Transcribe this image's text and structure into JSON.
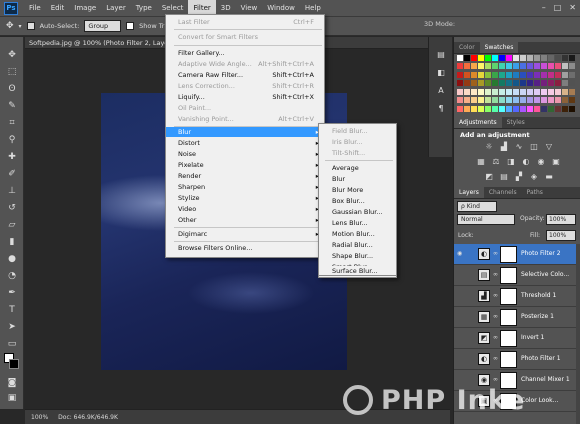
{
  "app": {
    "logo": "Ps",
    "window_controls": [
      "–",
      "□",
      "✕"
    ]
  },
  "menubar": {
    "items": [
      "File",
      "Edit",
      "Image",
      "Layer",
      "Type",
      "Select",
      "Filter",
      "3D",
      "View",
      "Window",
      "Help"
    ],
    "active": "Filter"
  },
  "options": {
    "auto_select_label": "Auto-Select:",
    "auto_select_value": "Group",
    "show_transform": "Show Trans",
    "mode_3d": "3D Mode:"
  },
  "document": {
    "tab_title": "Softpedia.jpg @ 100% (Photo Filter 2, Layer Mas",
    "zoom": "100%",
    "doc_size": "Doc: 646.9K/646.9K"
  },
  "filter_menu": {
    "items": [
      {
        "label": "Last Filter",
        "shortcut": "Ctrl+F",
        "disabled": true
      },
      {
        "label": "Convert for Smart Filters",
        "shortcut": "",
        "disabled": true
      },
      {
        "label": "Filter Gallery...",
        "shortcut": "",
        "disabled": false
      },
      {
        "label": "Adaptive Wide Angle...",
        "shortcut": "Alt+Shift+Ctrl+A",
        "disabled": true
      },
      {
        "label": "Camera Raw Filter...",
        "shortcut": "Shift+Ctrl+A",
        "disabled": false
      },
      {
        "label": "Lens Correction...",
        "shortcut": "Shift+Ctrl+R",
        "disabled": true
      },
      {
        "label": "Liquify...",
        "shortcut": "Shift+Ctrl+X",
        "disabled": false
      },
      {
        "label": "Oil Paint...",
        "shortcut": "",
        "disabled": true
      },
      {
        "label": "Vanishing Point...",
        "shortcut": "Alt+Ctrl+V",
        "disabled": true
      },
      {
        "label": "Blur",
        "submenu": true,
        "highlighted": true
      },
      {
        "label": "Distort",
        "submenu": true
      },
      {
        "label": "Noise",
        "submenu": true
      },
      {
        "label": "Pixelate",
        "submenu": true
      },
      {
        "label": "Render",
        "submenu": true
      },
      {
        "label": "Sharpen",
        "submenu": true
      },
      {
        "label": "Stylize",
        "submenu": true
      },
      {
        "label": "Video",
        "submenu": true
      },
      {
        "label": "Other",
        "submenu": true
      },
      {
        "label": "Digimarc",
        "submenu": true
      },
      {
        "label": "Browse Filters Online...",
        "shortcut": ""
      }
    ],
    "submenu_arrow": "▸"
  },
  "blur_submenu": {
    "items": [
      {
        "label": "Field Blur...",
        "disabled": true
      },
      {
        "label": "Iris Blur...",
        "disabled": true
      },
      {
        "label": "Tilt-Shift...",
        "disabled": true
      },
      {
        "label": "Average"
      },
      {
        "label": "Blur"
      },
      {
        "label": "Blur More"
      },
      {
        "label": "Box Blur..."
      },
      {
        "label": "Gaussian Blur..."
      },
      {
        "label": "Lens Blur..."
      },
      {
        "label": "Motion Blur..."
      },
      {
        "label": "Radial Blur..."
      },
      {
        "label": "Shape Blur..."
      },
      {
        "label": "Smart Blur..."
      },
      {
        "label": "Surface Blur..."
      }
    ]
  },
  "panels": {
    "color_tabs": [
      "Color",
      "Swatches"
    ],
    "adjust_tabs": [
      "Adjustments",
      "Styles"
    ],
    "adjust_title": "Add an adjustment",
    "layer_tabs": [
      "Layers",
      "Channels",
      "Paths"
    ],
    "kind_label": "ρ Kind",
    "blend_mode": "Normal",
    "opacity_label": "Opacity:",
    "opacity_value": "100%",
    "lock_label": "Lock:",
    "fill_label": "Fill:",
    "fill_value": "100%"
  },
  "layers": [
    {
      "name": "Photo Filter 2",
      "selected": true,
      "icon": "◐"
    },
    {
      "name": "Selective Colo...",
      "icon": "▤"
    },
    {
      "name": "Threshold 1",
      "icon": "▟"
    },
    {
      "name": "Posterize 1",
      "icon": "▦"
    },
    {
      "name": "Invert 1",
      "icon": "◩"
    },
    {
      "name": "Photo Filter 1",
      "icon": "◐"
    },
    {
      "name": "Channel Mixer 1",
      "icon": "◉"
    },
    {
      "name": "Color Look...",
      "icon": "▣"
    }
  ],
  "swatch_colors": [
    "#ffffff",
    "#000000",
    "#ff0000",
    "#ffff00",
    "#00ff00",
    "#00ffff",
    "#0000ff",
    "#ff00ff",
    "#e6e6e6",
    "#cccccc",
    "#b3b3b3",
    "#999999",
    "#808080",
    "#666666",
    "#4d4d4d",
    "#333333",
    "#1a1a1a",
    "#ee3b3b",
    "#f26d3d",
    "#f7a84a",
    "#fff56b",
    "#a8e063",
    "#5ed46e",
    "#3dd3b0",
    "#3ec8e8",
    "#3a9ee8",
    "#4a6fe3",
    "#6b56e0",
    "#9b4fe0",
    "#c84fd6",
    "#e84fae",
    "#e84f7a",
    "#c0c0c0",
    "#8c8c8c",
    "#c61a1a",
    "#d4521f",
    "#dd8a2a",
    "#e6d63a",
    "#86c03c",
    "#3aa64a",
    "#1ea88c",
    "#1fa0c0",
    "#1f7cc0",
    "#2a4fbf",
    "#4a35b8",
    "#7a2fb8",
    "#a52fae",
    "#c22f8a",
    "#c22f5a",
    "#a0a0a0",
    "#6e6e6e",
    "#8c1010",
    "#953a14",
    "#9e611c",
    "#a89a26",
    "#5f8a27",
    "#267a31",
    "#137a64",
    "#14728a",
    "#14588a",
    "#1c378a",
    "#332385",
    "#561f85",
    "#751f7d",
    "#8a1f62",
    "#8a1f40",
    "#7e7e7e",
    "#525252",
    "#f9c9c9",
    "#fbd9c5",
    "#fde8c6",
    "#fffac8",
    "#e0f3cc",
    "#c9efd0",
    "#c6efe6",
    "#c7ecf6",
    "#c7def6",
    "#cbd5f5",
    "#d4cdf4",
    "#e0cbf4",
    "#eecbf0",
    "#f6cbe4",
    "#f6cbd6",
    "#d9b48a",
    "#a67c52",
    "#f28c8c",
    "#f6ae88",
    "#f9cd8b",
    "#fdf18e",
    "#c4e59b",
    "#93dca0",
    "#8bdcc9",
    "#8dd7ee",
    "#8dbdee",
    "#97acea",
    "#a897e8",
    "#c197e8",
    "#db97e0",
    "#ec97c6",
    "#ec97ac",
    "#8c6239",
    "#603913",
    "#ff6666",
    "#ffaa55",
    "#ffdd55",
    "#ddff55",
    "#88ff66",
    "#55ffaa",
    "#55ffff",
    "#55aaff",
    "#5566ff",
    "#aa55ff",
    "#ff55ff",
    "#ff5599",
    "#333366",
    "#336633",
    "#663333",
    "#3e2209",
    "#1e0f00"
  ]
}
